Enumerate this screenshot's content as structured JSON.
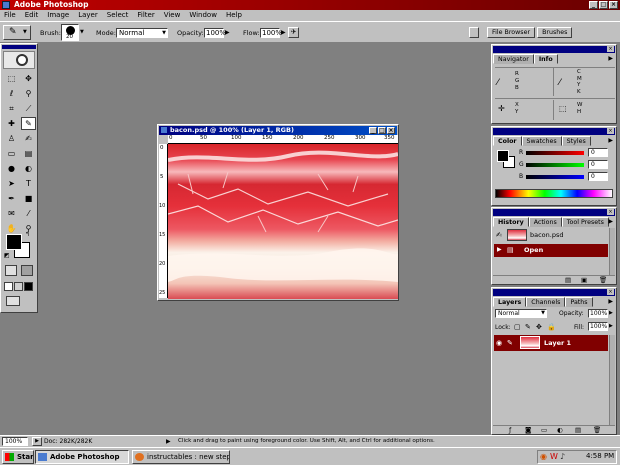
{
  "app_title": "Adobe Photoshop",
  "menus": [
    "File",
    "Edit",
    "Image",
    "Layer",
    "Select",
    "Filter",
    "View",
    "Window",
    "Help"
  ],
  "options": {
    "brush_label": "Brush:",
    "brush_size": "20",
    "mode_label": "Mode:",
    "mode_value": "Normal",
    "opacity_label": "Opacity:",
    "opacity_value": "100%",
    "flow_label": "Flow:",
    "flow_value": "100%",
    "palette_tabs": [
      "File Browser",
      "Brushes"
    ]
  },
  "document": {
    "title": "bacon.psd @ 100% (Layer 1, RGB)",
    "ruler_h": [
      "0",
      "50",
      "100",
      "150",
      "200",
      "250",
      "300",
      "350"
    ],
    "ruler_v": [
      "0",
      "5",
      "10",
      "15",
      "20",
      "25"
    ]
  },
  "nav_panel": {
    "tabs": [
      "Navigator",
      "Info"
    ],
    "active": "Info",
    "info_rgb": [
      "R",
      "G",
      "B"
    ],
    "info_cmyk": [
      "C",
      "M",
      "Y",
      "K"
    ],
    "info_xy": [
      "X",
      "Y"
    ],
    "info_wh": [
      "W",
      "H"
    ]
  },
  "color_panel": {
    "tabs": [
      "Color",
      "Swatches",
      "Styles"
    ],
    "channels": [
      {
        "label": "R",
        "value": "0"
      },
      {
        "label": "G",
        "value": "0"
      },
      {
        "label": "B",
        "value": "0"
      }
    ]
  },
  "history_panel": {
    "tabs": [
      "History",
      "Actions",
      "Tool Presets"
    ],
    "snapshot": "bacon.psd",
    "state": "Open"
  },
  "layers_panel": {
    "tabs": [
      "Layers",
      "Channels",
      "Paths"
    ],
    "blend": "Normal",
    "opacity_label": "Opacity:",
    "opacity_value": "100%",
    "lock_label": "Lock:",
    "fill_label": "Fill:",
    "fill_value": "100%",
    "layer_name": "Layer 1"
  },
  "status": {
    "zoom": "100%",
    "doc": "Doc: 282K/282K",
    "hint": "Click and drag to paint using foreground color.  Use Shift, Alt, and Ctrl for additional options."
  },
  "taskbar": {
    "start": "Start",
    "tasks": [
      "Adobe Photoshop",
      "instructables : new step ..."
    ],
    "clock": "4:58 PM"
  },
  "colors": {
    "title_bar": "#c00000",
    "doc_title": "#000080",
    "selection_red": "#800000"
  }
}
